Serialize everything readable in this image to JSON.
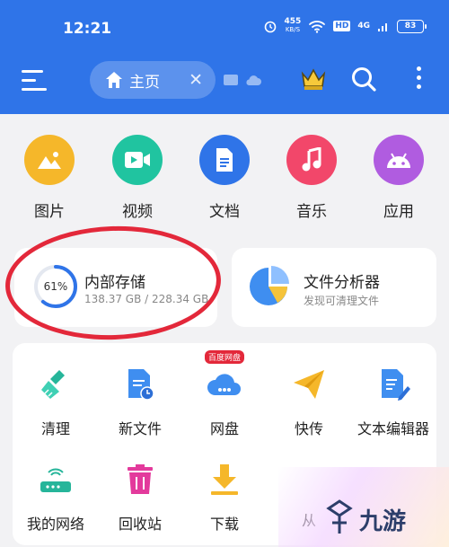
{
  "status_bar": {
    "time": "12:21",
    "net_speed": "455",
    "net_unit": "KB/S",
    "hd": "HD",
    "signal": "4G",
    "battery": "83"
  },
  "toolbar": {
    "home_tab_label": "主页",
    "close_symbol": "✕"
  },
  "categories": [
    {
      "label": "图片",
      "icon": "image-icon",
      "color": "#f5b72a"
    },
    {
      "label": "视频",
      "icon": "video-icon",
      "color": "#20c4a0"
    },
    {
      "label": "文档",
      "icon": "document-icon",
      "color": "#2f74e8"
    },
    {
      "label": "音乐",
      "icon": "music-icon",
      "color": "#f2476a"
    },
    {
      "label": "应用",
      "icon": "android-icon",
      "color": "#b05ce0"
    }
  ],
  "storage": {
    "percent_label": "61%",
    "percent": 61,
    "title": "内部存储",
    "usage": "138.37 GB / 228.34 GB"
  },
  "analyzer": {
    "title": "文件分析器",
    "subtitle": "发现可清理文件"
  },
  "tools": [
    {
      "label": "清理",
      "icon": "broom-icon"
    },
    {
      "label": "新文件",
      "icon": "new-file-icon"
    },
    {
      "label": "网盘",
      "icon": "cloud-drive-icon",
      "badge": "百度网盘"
    },
    {
      "label": "快传",
      "icon": "paper-plane-icon"
    },
    {
      "label": "文本编辑器",
      "icon": "text-editor-icon"
    },
    {
      "label": "我的网络",
      "icon": "router-icon"
    },
    {
      "label": "回收站",
      "icon": "trash-icon"
    },
    {
      "label": "下载",
      "icon": "download-icon"
    },
    {
      "label": "从",
      "icon": "partial-icon"
    }
  ],
  "watermark": {
    "text": "九游"
  }
}
